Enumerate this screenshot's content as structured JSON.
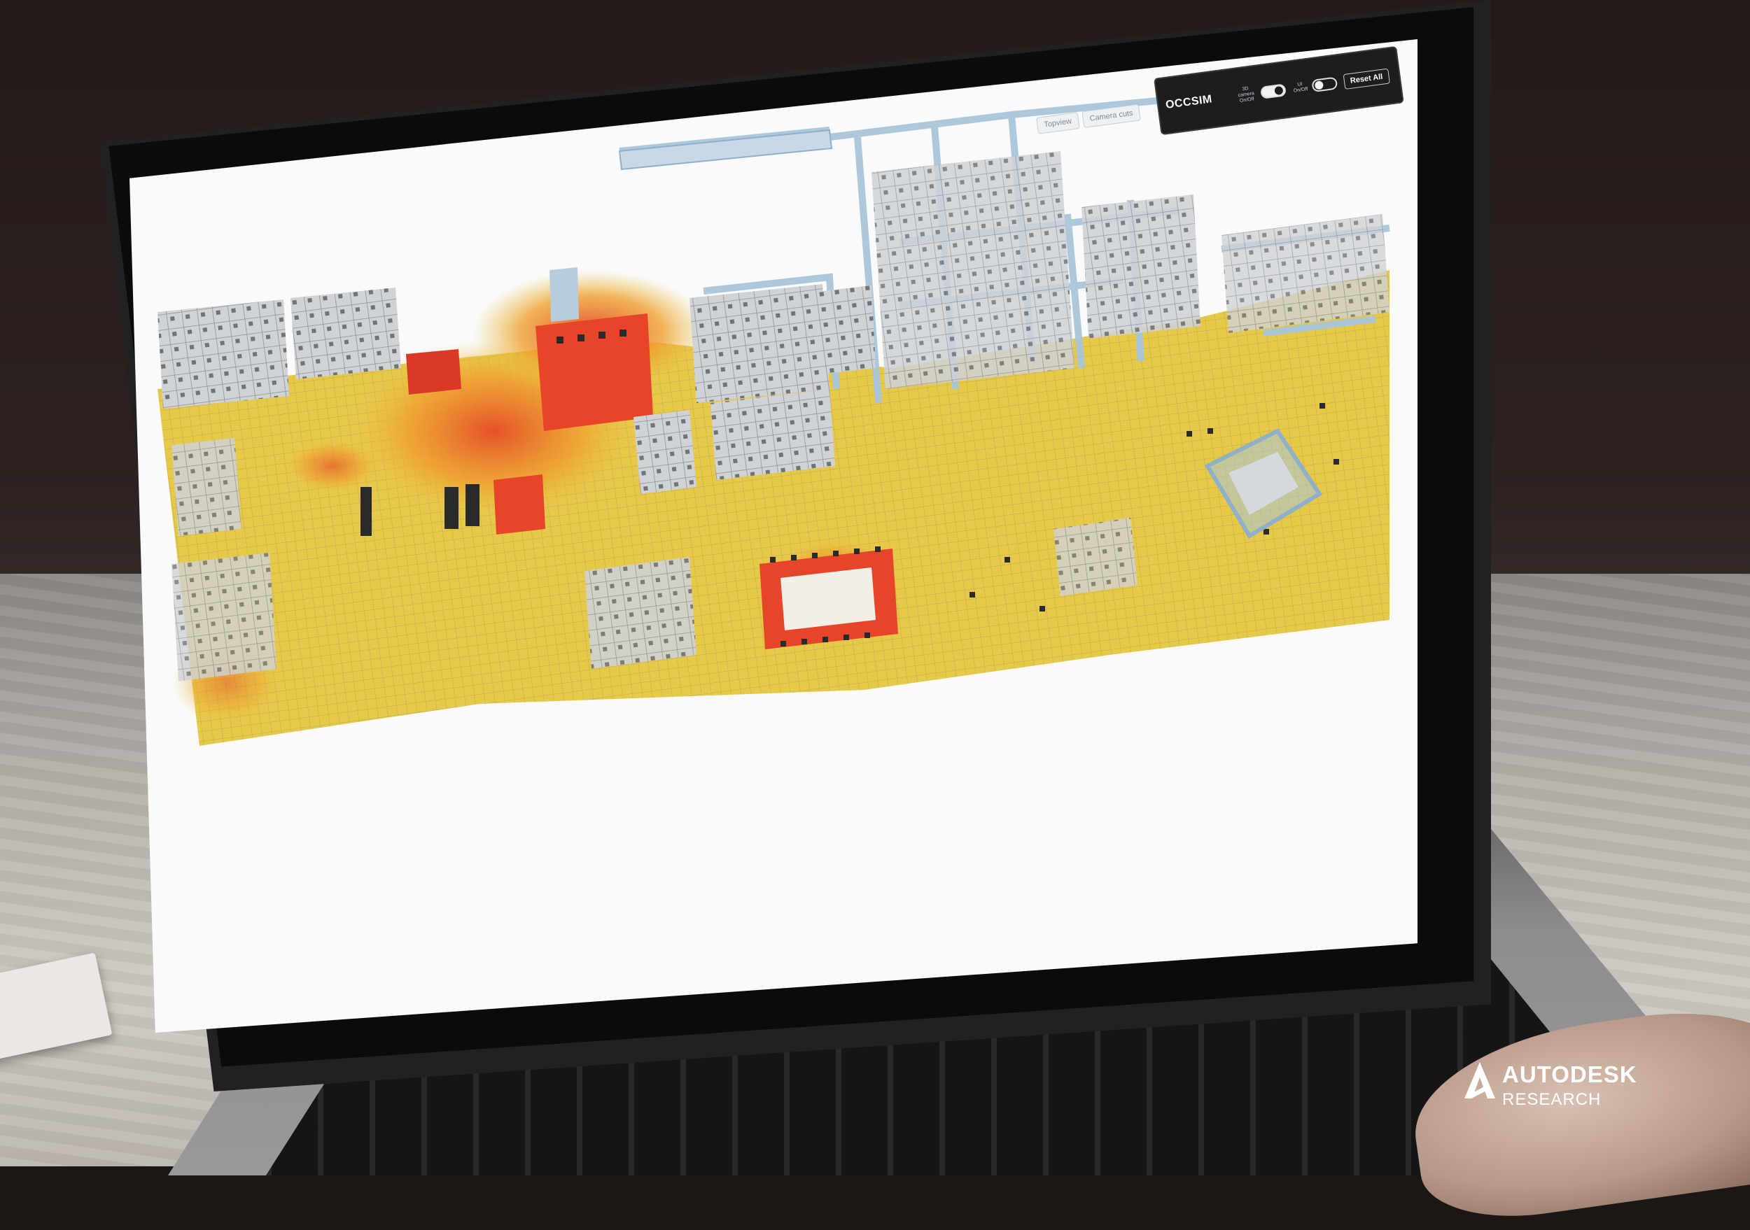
{
  "app": {
    "title": "OCCSIM",
    "view_buttons": [
      "Topview",
      "Camera cuts"
    ],
    "toggles": [
      {
        "label": "3D camera On/Off",
        "state": "on"
      },
      {
        "label": "UI On/Off",
        "state": "off"
      }
    ],
    "reset_label": "Reset All"
  },
  "colors": {
    "heat_low": "#e7c94a",
    "heat_mid": "#f0a030",
    "heat_high": "#e5502a",
    "wall_glass": "#a9c5da",
    "panel_bg": "#1d1d1f"
  },
  "brand": {
    "name": "AUTODESK",
    "sub": "RESEARCH",
    "icon": "autodesk-a-logo-icon"
  }
}
